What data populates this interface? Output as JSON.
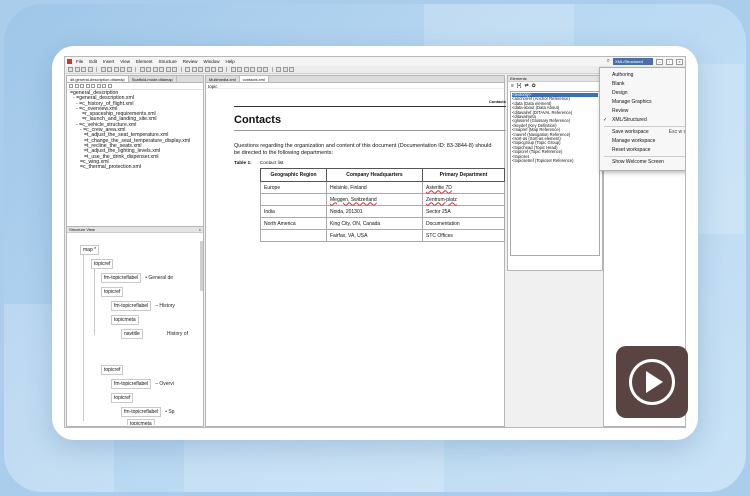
{
  "menubar": {
    "items": [
      "File",
      "Edit",
      "Insert",
      "View",
      "Element",
      "Structure",
      "Review",
      "Window",
      "Help"
    ],
    "perspective": "XML/Structured"
  },
  "left_pane": {
    "tabs": [
      "dit.general-description.ditamap",
      "Scaffold-mode.ditamap"
    ],
    "tree": [
      "=general_description",
      "- =general_description.xml",
      "  - =c_history_of_flight.xml",
      "  - =c_overview.xml",
      "    =r_spaceship_requirements.xml",
      "    =r_launch_and_landing_site.xml",
      "  - =c_vehicle_structure.xml",
      "    - =c_crew_area.xml",
      "      =t_adjust_the_seat_temperature.xml",
      "      =t_change_the_seat_temperature_display.xml",
      "      =t_recline_the_seats.xml",
      "      =t_adjust_the_lighting_levels.xml",
      "      =t_use_the_drink_dispenser.xml",
      "    =c_wing.xml",
      "    =c_thermal_protection.xml"
    ]
  },
  "structure_view": {
    "title": "Structure View",
    "nodes": {
      "map": "map *",
      "topicref1": "topicref",
      "fm_topicref1": "fm-topicreflabel",
      "fm_topicref1_text": "• General de",
      "topicref2": "topicref",
      "fm_topicref2": "fm-topicreflabel",
      "fm_topicref2_text": "– History",
      "topicmeta1": "topicmeta",
      "navtitle": "navtitle",
      "navtitle_text": "History of",
      "topicref3": "topicref",
      "fm_topicref3": "fm-topicreflabel",
      "fm_topicref3_text": "– Overvi",
      "topicref4": "topicref",
      "fm_topicref4": "fm-topicreflabel",
      "fm_topicref4_text": "• Sp",
      "topicmeta2": "topicmeta"
    }
  },
  "editor": {
    "tabs": [
      "Multimedia.xml",
      "contacts.xml"
    ],
    "breadcrumb": "topic",
    "running_head": "Contacts",
    "title": "Contacts",
    "paragraph": "Questions regarding the organization and content of this document (Documentation ID: 83-3844-8) should be directed to the following departments:",
    "table_label": "Table 1:",
    "table_caption": "Contact list",
    "table": {
      "headers": [
        "Geographic Region",
        "Company Headquarters",
        "Primary Department"
      ],
      "rows": [
        [
          "Europe",
          "Helsinki, Finland",
          "Asteritie 7D"
        ],
        [
          "",
          "Meggen, Switzerland",
          "Zentrum-platz"
        ],
        [
          "India",
          "Noida, 201301",
          "Sector 25A"
        ],
        [
          "North America",
          "King City, ON, Canada",
          "Documentation"
        ],
        [
          "",
          "Fairfax, VA, USA",
          "STC Offices"
        ]
      ]
    }
  },
  "elements_pane": {
    "title": "Elements",
    "tools": [
      "≡",
      "[•]",
      "⇄",
      "✿"
    ],
    "list": [
      "<textonly>",
      "<anchorref (Anchor Reference)",
      "<data (Data element)",
      "<data-about (Data About)",
      "<ditavalref (DITAVAL Reference)",
      "<ditavalmeta",
      "<glossref (Glossary Reference)",
      "<keydef (Key Definition)",
      "<mapref (Map Reference)",
      "<navref (Navigation Reference)",
      "<sort-as (Sort-as element)",
      "<topicgroup (Topic Group)",
      "<topichead (Topic Head)",
      "<topicref (Topic Reference)",
      "<topicset",
      "<topicsetref (Topicset Reference)"
    ]
  },
  "perspective_menu": {
    "items": [
      "Authoring",
      "Blank",
      "Design",
      "Manage Graphics",
      "Review",
      "XML/Structured"
    ],
    "checked": "XML/Structured",
    "actions": [
      "Save workspace",
      "Manage workspace",
      "Reset workspace"
    ],
    "save_shortcut": "Esc w s",
    "footer": "Show Welcome Screen"
  }
}
